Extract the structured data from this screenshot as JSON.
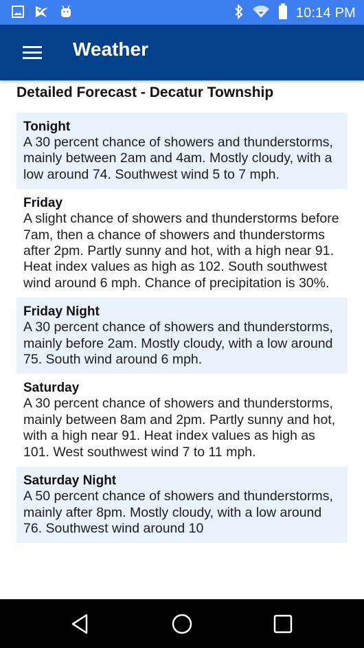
{
  "status_bar": {
    "left_icons": [
      "gallery-icon",
      "task-check-icon",
      "android-icon"
    ],
    "right_icons": [
      "bluetooth-icon",
      "wifi-icon",
      "battery-icon"
    ],
    "time": "10:14 PM"
  },
  "app_bar": {
    "title": "Weather",
    "menu_icon": "hamburger-menu-icon"
  },
  "page": {
    "title": "Detailed Forecast - Decatur Township"
  },
  "forecast": [
    {
      "period": "Tonight",
      "text": "A 30 percent chance of showers and thunderstorms, mainly between 2am and 4am. Mostly cloudy, with a low around 74. Southwest wind 5 to 7 mph."
    },
    {
      "period": "Friday",
      "text": "A slight chance of showers and thunderstorms before 7am, then a chance of showers and thunderstorms after 2pm. Partly sunny and hot, with a high near 91. Heat index values as high as 102. South southwest wind around 6 mph. Chance of precipitation is 30%."
    },
    {
      "period": "Friday Night",
      "text": "A 30 percent chance of showers and thunderstorms, mainly before 2am. Mostly cloudy, with a low around 75. South wind around 6 mph."
    },
    {
      "period": "Saturday",
      "text": "A 30 percent chance of showers and thunderstorms, mainly between 8am and 2pm. Partly sunny and hot, with a high near 91. Heat index values as high as 101. West southwest wind 7 to 11 mph."
    },
    {
      "period": "Saturday Night",
      "text": "A 50 percent chance of showers and thunderstorms, mainly after 8pm. Mostly cloudy, with a low around 76. Southwest wind around 10"
    }
  ],
  "nav_bar": {
    "buttons": [
      "back-icon",
      "home-icon",
      "recents-icon"
    ]
  },
  "colors": {
    "status_bar": "#3d7ef0",
    "app_bar": "#04418b",
    "card_alt": "#eaf3fc"
  }
}
